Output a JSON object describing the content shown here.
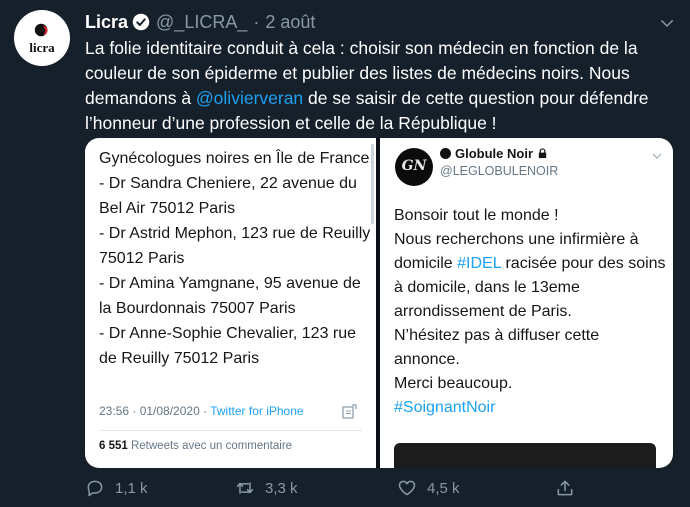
{
  "tweet": {
    "author_name": "Licra",
    "handle": "@_LICRA_",
    "separator": "·",
    "date": "2 août",
    "avatar_text": "licra",
    "text_before_mention": "La folie identitaire conduit à cela : choisir son médecin en fonction de la couleur de son épiderme et publier des listes de médecins noirs. Nous demandons à ",
    "mention": "@olivierveran",
    "text_after_mention": " de se saisir de cette question pour défendre l’honneur d’une profession et celle de la République !"
  },
  "media_left": {
    "lines": [
      "Gynécologues noires en Île de France.",
      "- Dr Sandra Cheniere, 22 avenue du Bel Air 75012 Paris",
      "- Dr Astrid Mephon, 123 rue de Reuilly 75012 Paris",
      "- Dr Amina Yamgnane, 95 avenue de la Bourdonnais 75007 Paris",
      "- Dr Anne-Sophie Chevalier, 123 rue de Reuilly 75012 Paris"
    ],
    "timestamp": "23:56 · 01/08/2020 · ",
    "source": "Twitter for iPhone",
    "retweet_count": "6 551",
    "retweet_label": " Retweets avec un commentaire"
  },
  "media_right": {
    "avatar_text": "GN",
    "name": "Globule Noir",
    "handle": "@LEGLOBULENOIR",
    "line1": "Bonsoir tout le monde !",
    "line2_before": "Nous recherchons une infirmière à domicile ",
    "hashtag1": "#IDEL",
    "line2_after": " racisée pour des soins à domicile, dans le 13eme arrondissement de Paris.",
    "line3": "N’hésitez pas à diffuser cette annonce.",
    "line4": "Merci beaucoup.",
    "hashtag2": "#SoignantNoir"
  },
  "actions": {
    "reply_count": "1,1 k",
    "retweet_count": "3,3 k",
    "like_count": "4,5 k"
  },
  "colors": {
    "background": "#15202b",
    "accent": "#1da1f2",
    "muted": "#8899a6"
  }
}
